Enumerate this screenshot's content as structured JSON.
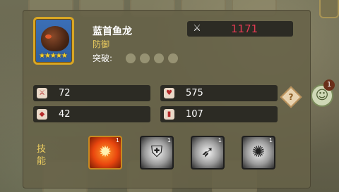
{
  "hero": {
    "name": "蓝首鱼龙",
    "role": "防御",
    "breakthrough_label": "突破:",
    "breakthrough_dots": 4,
    "star_count": 5,
    "power_icon": "crossed-swords-icon",
    "power": "1171"
  },
  "stats": [
    {
      "icon": "sword-icon",
      "value": "72"
    },
    {
      "icon": "heart-icon",
      "value": "575"
    },
    {
      "icon": "shield-icon",
      "value": "42"
    },
    {
      "icon": "bar-chart-icon",
      "value": "107"
    }
  ],
  "skills_label": "技能",
  "skills": [
    {
      "icon": "fire-burst-icon",
      "level": "1"
    },
    {
      "icon": "shield-spikes-icon",
      "level": "1"
    },
    {
      "icon": "bite-icon",
      "level": "1"
    },
    {
      "icon": "dark-orb-icon",
      "level": "1"
    }
  ],
  "help_button": "?",
  "side_badge": "1",
  "colors": {
    "power_red": "#e23a52",
    "gold": "#f0d060",
    "stat_bg": "#2c2b24"
  }
}
